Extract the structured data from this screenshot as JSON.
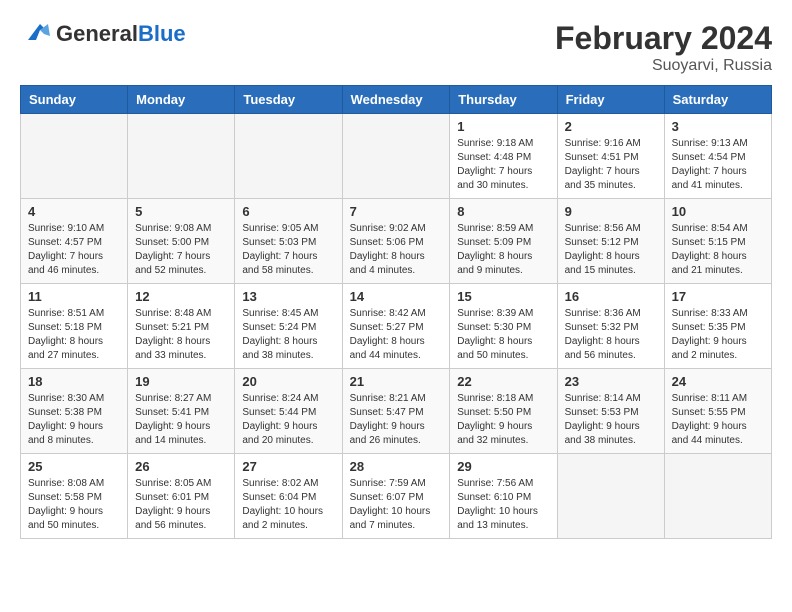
{
  "header": {
    "logo_general": "General",
    "logo_blue": "Blue",
    "title": "February 2024",
    "subtitle": "Suoyarvi, Russia"
  },
  "weekdays": [
    "Sunday",
    "Monday",
    "Tuesday",
    "Wednesday",
    "Thursday",
    "Friday",
    "Saturday"
  ],
  "weeks": [
    [
      {
        "day": "",
        "info": ""
      },
      {
        "day": "",
        "info": ""
      },
      {
        "day": "",
        "info": ""
      },
      {
        "day": "",
        "info": ""
      },
      {
        "day": "1",
        "info": "Sunrise: 9:18 AM\nSunset: 4:48 PM\nDaylight: 7 hours\nand 30 minutes."
      },
      {
        "day": "2",
        "info": "Sunrise: 9:16 AM\nSunset: 4:51 PM\nDaylight: 7 hours\nand 35 minutes."
      },
      {
        "day": "3",
        "info": "Sunrise: 9:13 AM\nSunset: 4:54 PM\nDaylight: 7 hours\nand 41 minutes."
      }
    ],
    [
      {
        "day": "4",
        "info": "Sunrise: 9:10 AM\nSunset: 4:57 PM\nDaylight: 7 hours\nand 46 minutes."
      },
      {
        "day": "5",
        "info": "Sunrise: 9:08 AM\nSunset: 5:00 PM\nDaylight: 7 hours\nand 52 minutes."
      },
      {
        "day": "6",
        "info": "Sunrise: 9:05 AM\nSunset: 5:03 PM\nDaylight: 7 hours\nand 58 minutes."
      },
      {
        "day": "7",
        "info": "Sunrise: 9:02 AM\nSunset: 5:06 PM\nDaylight: 8 hours\nand 4 minutes."
      },
      {
        "day": "8",
        "info": "Sunrise: 8:59 AM\nSunset: 5:09 PM\nDaylight: 8 hours\nand 9 minutes."
      },
      {
        "day": "9",
        "info": "Sunrise: 8:56 AM\nSunset: 5:12 PM\nDaylight: 8 hours\nand 15 minutes."
      },
      {
        "day": "10",
        "info": "Sunrise: 8:54 AM\nSunset: 5:15 PM\nDaylight: 8 hours\nand 21 minutes."
      }
    ],
    [
      {
        "day": "11",
        "info": "Sunrise: 8:51 AM\nSunset: 5:18 PM\nDaylight: 8 hours\nand 27 minutes."
      },
      {
        "day": "12",
        "info": "Sunrise: 8:48 AM\nSunset: 5:21 PM\nDaylight: 8 hours\nand 33 minutes."
      },
      {
        "day": "13",
        "info": "Sunrise: 8:45 AM\nSunset: 5:24 PM\nDaylight: 8 hours\nand 38 minutes."
      },
      {
        "day": "14",
        "info": "Sunrise: 8:42 AM\nSunset: 5:27 PM\nDaylight: 8 hours\nand 44 minutes."
      },
      {
        "day": "15",
        "info": "Sunrise: 8:39 AM\nSunset: 5:30 PM\nDaylight: 8 hours\nand 50 minutes."
      },
      {
        "day": "16",
        "info": "Sunrise: 8:36 AM\nSunset: 5:32 PM\nDaylight: 8 hours\nand 56 minutes."
      },
      {
        "day": "17",
        "info": "Sunrise: 8:33 AM\nSunset: 5:35 PM\nDaylight: 9 hours\nand 2 minutes."
      }
    ],
    [
      {
        "day": "18",
        "info": "Sunrise: 8:30 AM\nSunset: 5:38 PM\nDaylight: 9 hours\nand 8 minutes."
      },
      {
        "day": "19",
        "info": "Sunrise: 8:27 AM\nSunset: 5:41 PM\nDaylight: 9 hours\nand 14 minutes."
      },
      {
        "day": "20",
        "info": "Sunrise: 8:24 AM\nSunset: 5:44 PM\nDaylight: 9 hours\nand 20 minutes."
      },
      {
        "day": "21",
        "info": "Sunrise: 8:21 AM\nSunset: 5:47 PM\nDaylight: 9 hours\nand 26 minutes."
      },
      {
        "day": "22",
        "info": "Sunrise: 8:18 AM\nSunset: 5:50 PM\nDaylight: 9 hours\nand 32 minutes."
      },
      {
        "day": "23",
        "info": "Sunrise: 8:14 AM\nSunset: 5:53 PM\nDaylight: 9 hours\nand 38 minutes."
      },
      {
        "day": "24",
        "info": "Sunrise: 8:11 AM\nSunset: 5:55 PM\nDaylight: 9 hours\nand 44 minutes."
      }
    ],
    [
      {
        "day": "25",
        "info": "Sunrise: 8:08 AM\nSunset: 5:58 PM\nDaylight: 9 hours\nand 50 minutes."
      },
      {
        "day": "26",
        "info": "Sunrise: 8:05 AM\nSunset: 6:01 PM\nDaylight: 9 hours\nand 56 minutes."
      },
      {
        "day": "27",
        "info": "Sunrise: 8:02 AM\nSunset: 6:04 PM\nDaylight: 10 hours\nand 2 minutes."
      },
      {
        "day": "28",
        "info": "Sunrise: 7:59 AM\nSunset: 6:07 PM\nDaylight: 10 hours\nand 7 minutes."
      },
      {
        "day": "29",
        "info": "Sunrise: 7:56 AM\nSunset: 6:10 PM\nDaylight: 10 hours\nand 13 minutes."
      },
      {
        "day": "",
        "info": ""
      },
      {
        "day": "",
        "info": ""
      }
    ]
  ]
}
